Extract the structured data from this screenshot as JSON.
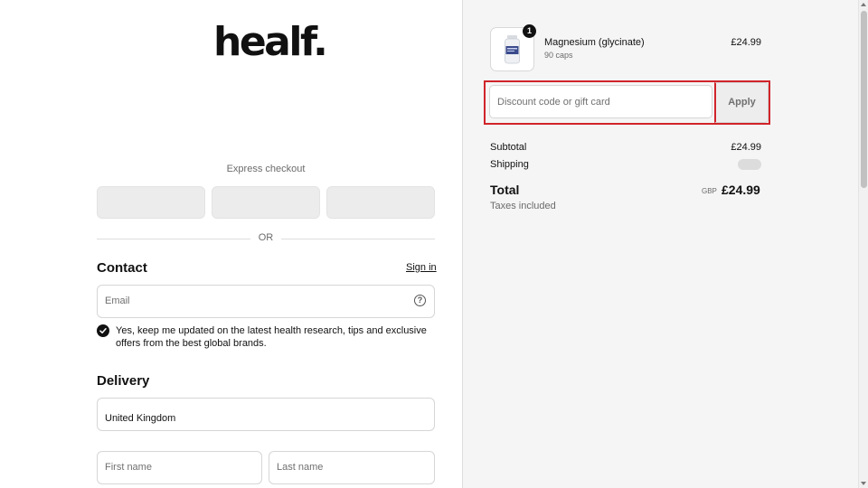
{
  "brand": {
    "logo_text": "healf."
  },
  "checkout": {
    "express_label": "Express checkout",
    "or_label": "OR",
    "contact": {
      "title": "Contact",
      "sign_in": "Sign in",
      "email_placeholder": "Email",
      "marketing_consent": "Yes, keep me updated on the latest health research, tips and exclusive offers from the best global brands.",
      "marketing_checked": true
    },
    "delivery": {
      "title": "Delivery",
      "country": "United Kingdom",
      "first_name_placeholder": "First name",
      "last_name_placeholder": "Last name"
    }
  },
  "order_summary": {
    "item": {
      "name": "Magnesium (glycinate)",
      "variant": "90 caps",
      "price": "£24.99",
      "quantity": "1"
    },
    "discount": {
      "placeholder": "Discount code or gift card",
      "apply_label": "Apply"
    },
    "subtotal_label": "Subtotal",
    "subtotal_value": "£24.99",
    "shipping_label": "Shipping",
    "total_label": "Total",
    "total_currency": "GBP",
    "total_value": "£24.99",
    "taxes_note": "Taxes included"
  },
  "colors": {
    "highlight": "#d0242a",
    "summary_bg": "#f5f5f5"
  }
}
